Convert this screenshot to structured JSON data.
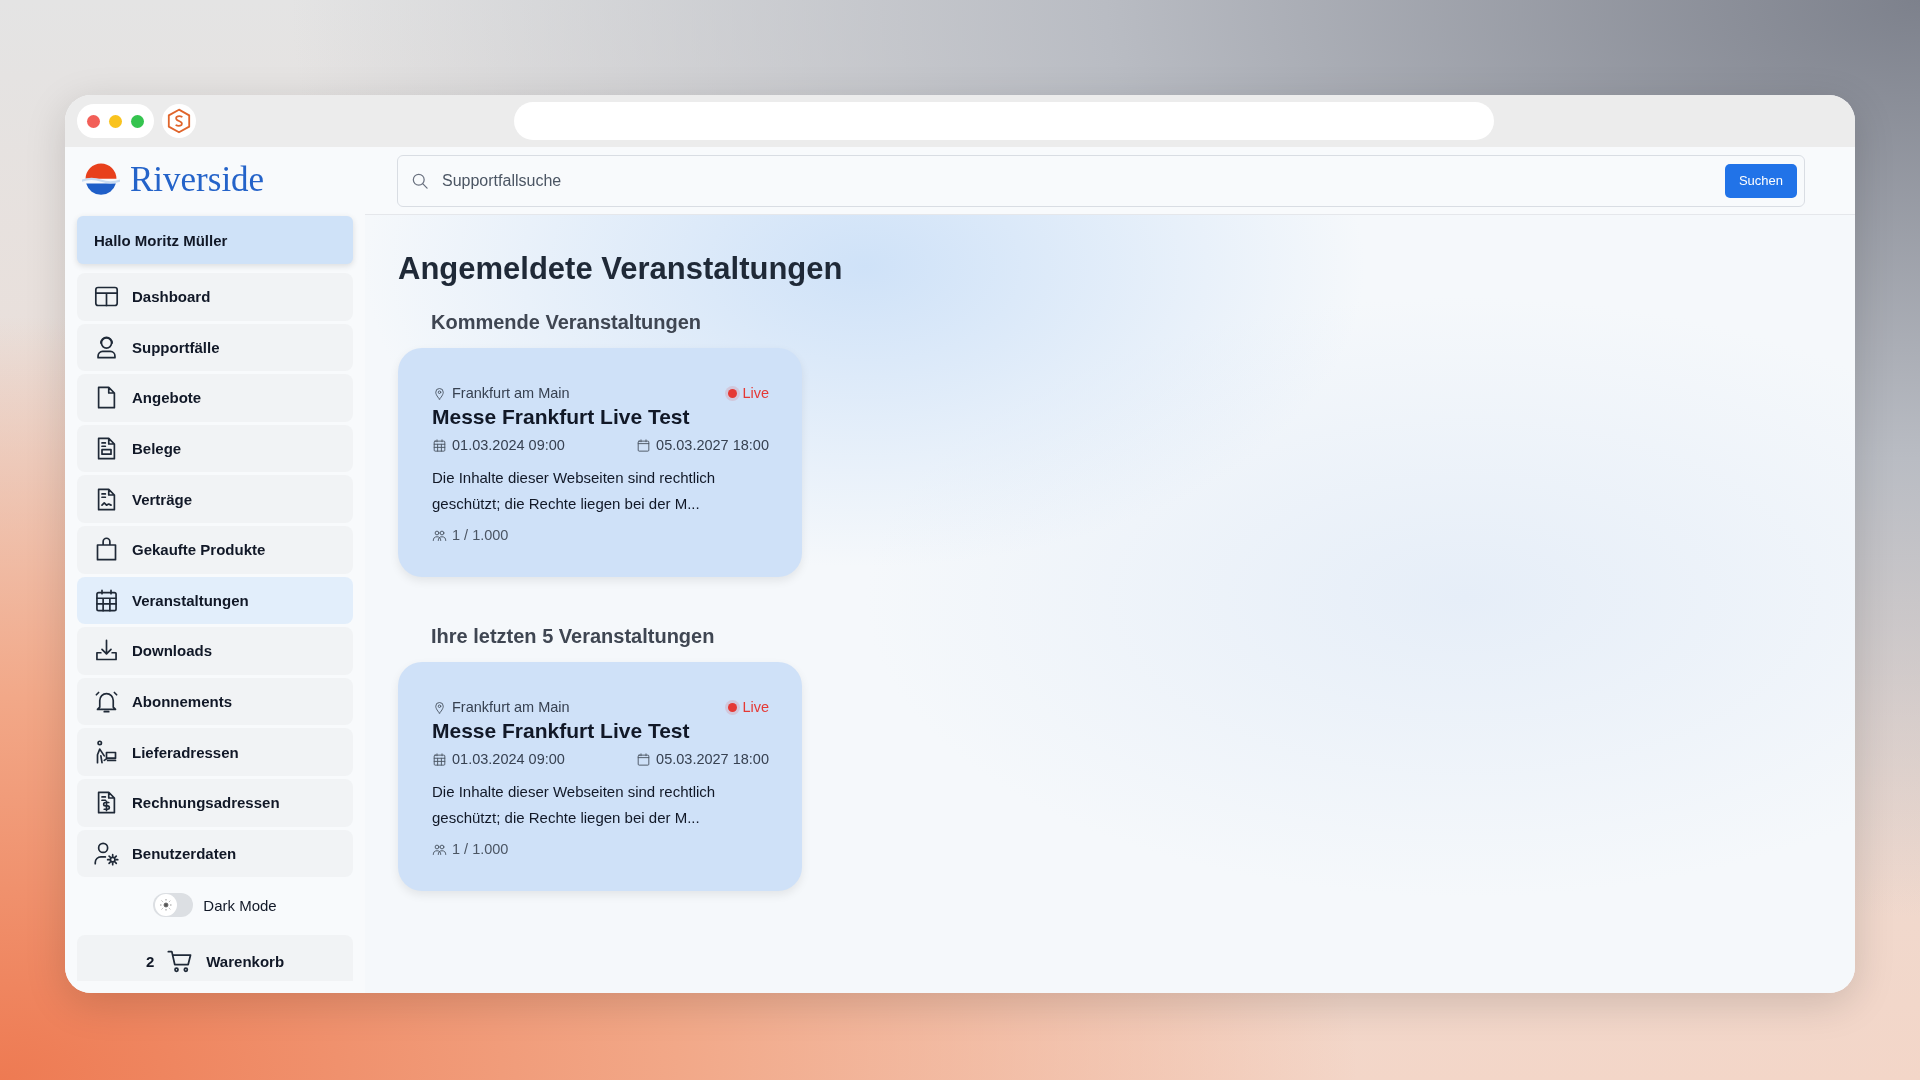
{
  "sidebar": {
    "logo": "Riverside",
    "greeting": "Hallo Moritz Müller",
    "items": [
      {
        "label": "Dashboard",
        "selected": false
      },
      {
        "label": "Supportfälle",
        "selected": false
      },
      {
        "label": "Angebote",
        "selected": false
      },
      {
        "label": "Belege",
        "selected": false
      },
      {
        "label": "Verträge",
        "selected": false
      },
      {
        "label": "Gekaufte Produkte",
        "selected": false
      },
      {
        "label": "Veranstaltungen",
        "selected": true
      },
      {
        "label": "Downloads",
        "selected": false
      },
      {
        "label": "Abonnements",
        "selected": false
      },
      {
        "label": "Lieferadressen",
        "selected": false
      },
      {
        "label": "Rechnungsadressen",
        "selected": false
      },
      {
        "label": "Benutzerdaten",
        "selected": false
      }
    ],
    "dark_mode": {
      "label": "Dark Mode",
      "on": false
    },
    "cart": {
      "count": "2",
      "label": "Warenkorb"
    }
  },
  "search": {
    "placeholder": "Supportfallsuche",
    "button": "Suchen"
  },
  "page_title": "Angemeldete Veranstaltungen",
  "sections": [
    {
      "title": "Kommende Veranstaltungen",
      "events": [
        {
          "location": "Frankfurt am Main",
          "live": true,
          "live_label": "Live",
          "title": "Messe Frankfurt Live Test",
          "start": "01.03.2024 09:00",
          "end": "05.03.2027 18:00",
          "description": "Die Inhalte dieser Webseiten sind rechtlich geschützt; die Rechte liegen bei der M...",
          "attendees": "1 / 1.000"
        }
      ]
    },
    {
      "title": "Ihre letzten 5 Veranstaltungen",
      "events": [
        {
          "location": "Frankfurt am Main",
          "live": true,
          "live_label": "Live",
          "title": "Messe Frankfurt Live Test",
          "start": "01.03.2024 09:00",
          "end": "05.03.2027 18:00",
          "description": "Die Inhalte dieser Webseiten sind rechtlich geschützt; die Rechte liegen bei der M...",
          "attendees": "1 / 1.000"
        }
      ]
    }
  ]
}
